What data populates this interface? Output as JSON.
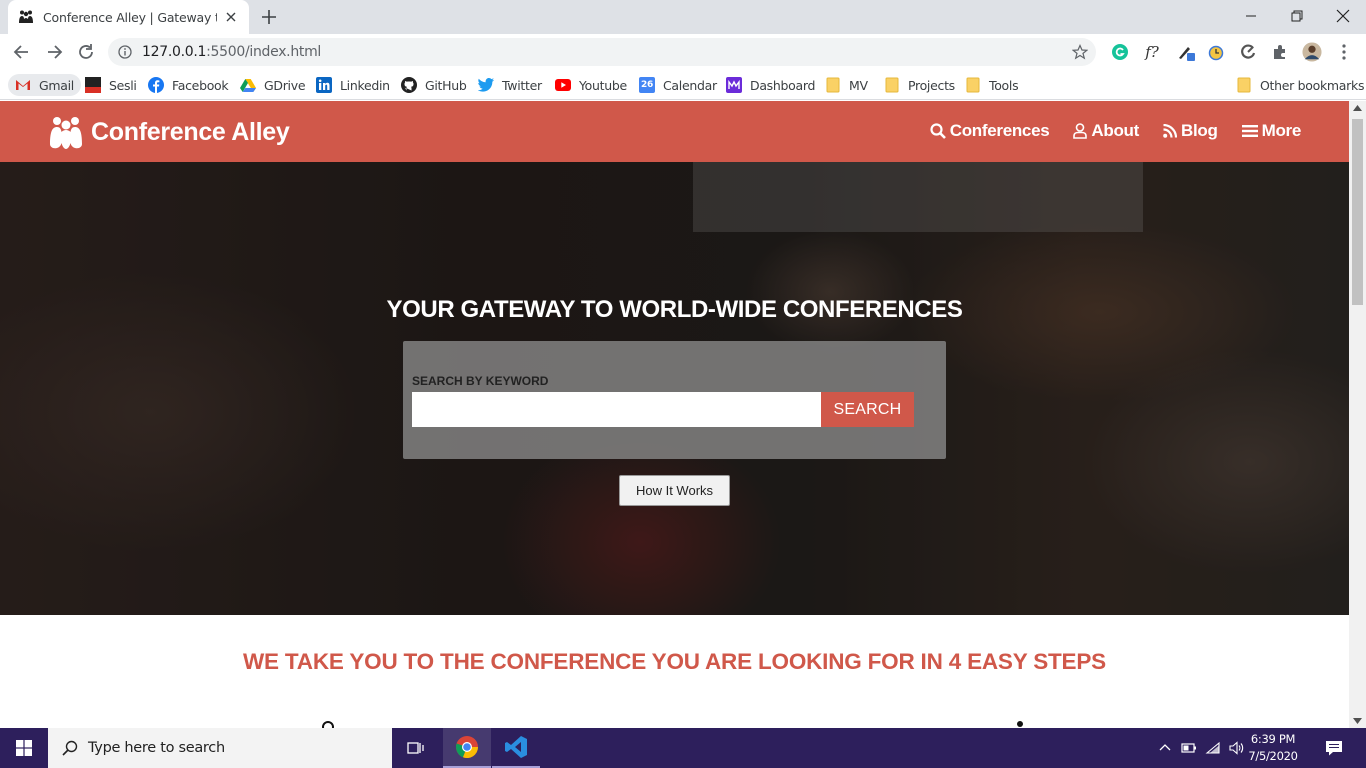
{
  "browser": {
    "tab_title": "Conference Alley | Gateway to W",
    "url_host": "127.0.0.1",
    "url_path": ":5500/index.html",
    "bookmarks": [
      {
        "label": "Gmail",
        "icon": "gmail-icon"
      },
      {
        "label": "Sesli",
        "icon": "sesli-icon"
      },
      {
        "label": "Facebook",
        "icon": "facebook-icon"
      },
      {
        "label": "GDrive",
        "icon": "gdrive-icon"
      },
      {
        "label": "Linkedin",
        "icon": "linkedin-icon"
      },
      {
        "label": "GitHub",
        "icon": "github-icon"
      },
      {
        "label": "Twitter",
        "icon": "twitter-icon"
      },
      {
        "label": "Youtube",
        "icon": "youtube-icon"
      },
      {
        "label": "Calendar",
        "icon": "calendar-icon"
      },
      {
        "label": "Dashboard",
        "icon": "dashboard-icon"
      },
      {
        "label": "MV",
        "icon": "folder-icon"
      },
      {
        "label": "Projects",
        "icon": "folder-icon"
      },
      {
        "label": "Tools",
        "icon": "folder-icon"
      }
    ],
    "other_bookmarks": "Other bookmarks",
    "calendar_day": "26"
  },
  "site": {
    "brand": "Conference Alley",
    "nav": [
      {
        "label": "Conferences",
        "icon": "search-icon"
      },
      {
        "label": "About",
        "icon": "user-icon"
      },
      {
        "label": "Blog",
        "icon": "rss-icon"
      },
      {
        "label": "More",
        "icon": "menu-icon"
      }
    ],
    "hero_title": "YOUR GATEWAY TO WORLD-WIDE CONFERENCES",
    "search_label": "SEARCH BY KEYWORD",
    "search_value": "",
    "search_button": "SEARCH",
    "how_button": "How It Works",
    "steps_title": "WE TAKE YOU TO THE CONFERENCE YOU ARE LOOKING FOR IN 4 EASY STEPS"
  },
  "taskbar": {
    "search_placeholder": "Type here to search",
    "time": "6:39 PM",
    "date": "7/5/2020"
  },
  "colors": {
    "brand": "#d0584a",
    "taskbar": "#2d1f5c",
    "tabstrip": "#dee1e6"
  }
}
